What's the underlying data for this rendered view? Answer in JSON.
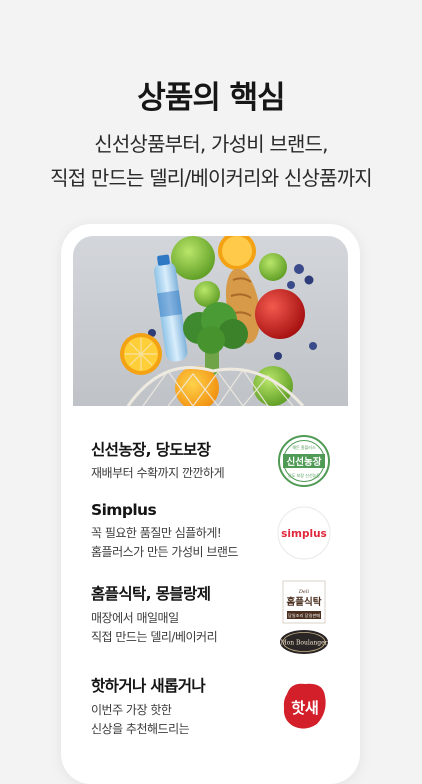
{
  "headline": "상품의 핵심",
  "subline": {
    "line1": "신선상품부터, 가성비 브랜드,",
    "line2": "직접 만드는 델리/베이커리와 신상품까지"
  },
  "features": [
    {
      "title": "신선농장, 당도보장",
      "desc_lines": [
        "재배부터 수확까지 깐깐하게"
      ],
      "logo": {
        "main": "신선농장",
        "arc_top": "해든 홈플러스",
        "arc_bottom": "당도 보장 신선농장"
      }
    },
    {
      "title": "Simplus",
      "desc_lines": [
        "꼭 필요한 품질만 심플하게!",
        "홈플러스가 만든 가성비 브랜드"
      ],
      "logo": {
        "main": "simplus"
      }
    },
    {
      "title": "홈플식탁, 몽블랑제",
      "desc_lines": [
        "매장에서 매일매일",
        "직접 만드는 델리/베이커리"
      ],
      "logo": {
        "main": "홈플식탁",
        "small_top": "Deli",
        "badge_text": "당일조리 당일판매",
        "secondary": "Mon Boulanger"
      }
    },
    {
      "title": "핫하거나 새롭거나",
      "desc_lines": [
        "이번주 가장 핫한",
        "신상을 추천해드리는"
      ],
      "logo": {
        "main": "핫새"
      }
    }
  ],
  "colors": {
    "background": "#f3f3f3",
    "card": "#ffffff",
    "fresh_green": "#4f9a55",
    "simplus_red": "#e1283c",
    "deli_brown": "#4a2e1e",
    "hot_red": "#d21f2a"
  }
}
